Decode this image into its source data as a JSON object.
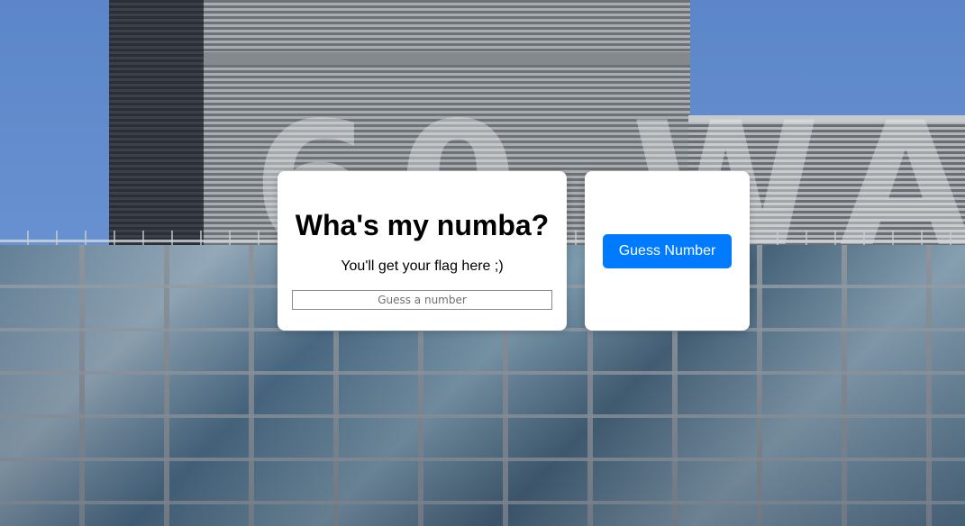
{
  "main_card": {
    "title": "Wha's my numba?",
    "subtitle": "You'll get your flag here ;)",
    "guess_input": {
      "value": "",
      "placeholder": "Guess a number"
    }
  },
  "action_card": {
    "guess_button_label": "Guess Number"
  },
  "colors": {
    "button_primary": "#007bff",
    "card_background": "#ffffff"
  }
}
